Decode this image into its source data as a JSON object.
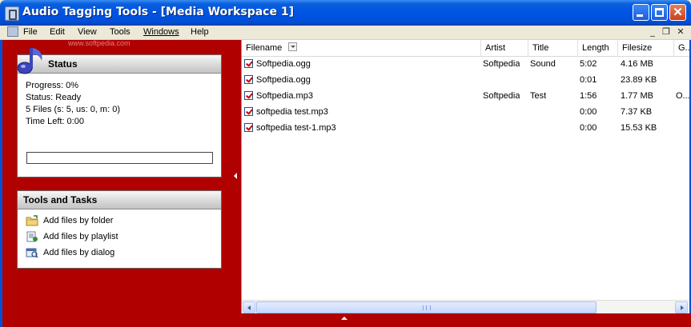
{
  "window": {
    "title": "Audio Tagging Tools - [Media Workspace 1]",
    "controls": {
      "minimize": "minimize",
      "maximize": "maximize",
      "close": "✕"
    }
  },
  "menu": {
    "items": [
      "File",
      "Edit",
      "View",
      "Tools",
      "Windows",
      "Help"
    ],
    "mdi": {
      "minimize": "_",
      "restore": "❐",
      "close": "✕"
    }
  },
  "watermark": "www.softpedia.com",
  "status": {
    "title": "Status",
    "progress": "Progress: 0%",
    "status": "Status: Ready",
    "files": "5 Files (s: 5, us: 0, m: 0)",
    "time_left": "Time Left: 0:00",
    "progress_value": 0
  },
  "tasks": {
    "title": "Tools and Tasks",
    "items": [
      {
        "label": "Add files by folder",
        "icon": "folder-icon"
      },
      {
        "label": "Add files by playlist",
        "icon": "playlist-icon"
      },
      {
        "label": "Add files by dialog",
        "icon": "dialog-icon"
      }
    ]
  },
  "list": {
    "columns": [
      "Filename",
      "Artist",
      "Title",
      "Length",
      "Filesize",
      "G..."
    ],
    "rows": [
      {
        "checked": true,
        "filename": "Softpedia.ogg",
        "artist": "Softpedia",
        "title": "Sound",
        "length": "5:02",
        "filesize": "4.16 MB",
        "genre": ""
      },
      {
        "checked": true,
        "filename": "Softpedia.ogg",
        "artist": "",
        "title": "",
        "length": "0:01",
        "filesize": "23.89 KB",
        "genre": ""
      },
      {
        "checked": true,
        "filename": "Softpedia.mp3",
        "artist": "Softpedia",
        "title": "Test",
        "length": "1:56",
        "filesize": "1.77 MB",
        "genre": "O..."
      },
      {
        "checked": true,
        "filename": "softpedia test.mp3",
        "artist": "",
        "title": "",
        "length": "0:00",
        "filesize": "7.37 KB",
        "genre": ""
      },
      {
        "checked": true,
        "filename": "softpedia test-1.mp3",
        "artist": "",
        "title": "",
        "length": "0:00",
        "filesize": "15.53 KB",
        "genre": ""
      }
    ]
  },
  "colors": {
    "panel_red": "#b00000",
    "titlebar_blue": "#0054e3",
    "checkmark_red": "#cc0000"
  }
}
